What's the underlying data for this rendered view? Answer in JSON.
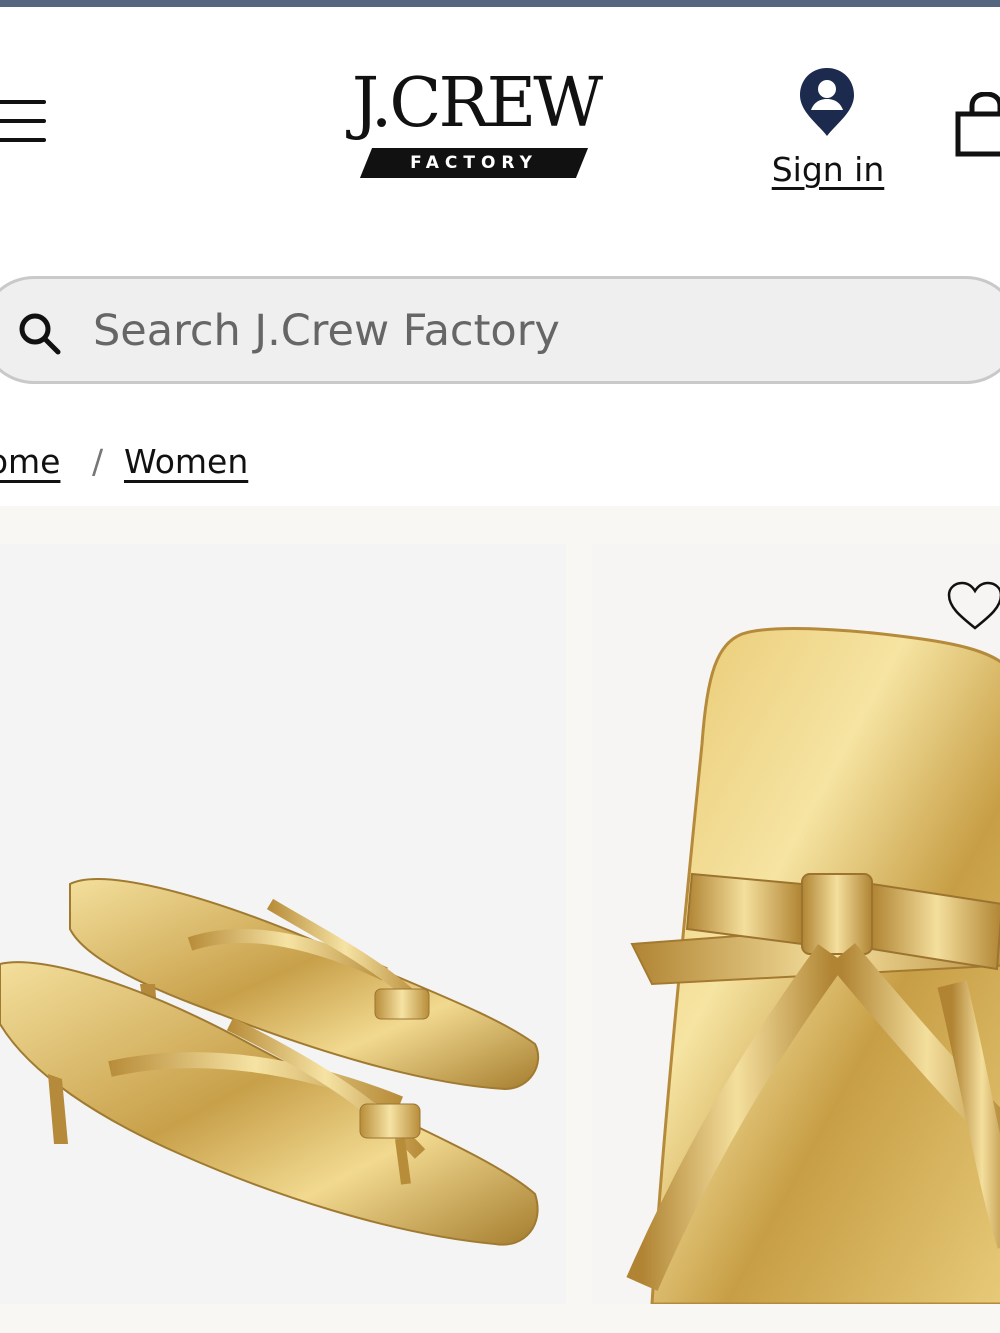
{
  "header": {
    "brand_name": "J.CREW",
    "brand_sub": "FACTORY",
    "menu_icon": "hamburger-menu-icon",
    "account_icon": "account-pin-icon",
    "sign_in_label": "Sign in",
    "bag_icon": "shopping-bag-icon"
  },
  "search": {
    "placeholder": "Search J.Crew Factory",
    "value": "",
    "icon": "search-icon"
  },
  "breadcrumb": {
    "items": [
      {
        "label": "Home"
      },
      {
        "label": "Women"
      }
    ],
    "separator": "/"
  },
  "gallery": {
    "images": [
      {
        "alt": "Gold metallic kitten-heel thong sandals with bow, pair view"
      },
      {
        "alt": "Gold metallic sandal close-up of bow detail"
      }
    ],
    "wishlist_icon": "heart-icon"
  },
  "colors": {
    "top_rule": "#55677f",
    "brand_navy": "#1c2a4e",
    "search_bg": "#efefef",
    "gallery_bg": "#f8f7f4",
    "gold": "#c9a24a"
  }
}
